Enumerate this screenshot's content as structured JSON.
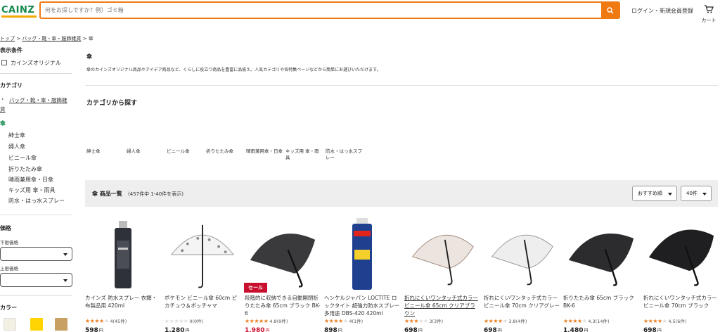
{
  "header": {
    "logo": "CAINZ",
    "search_placeholder": "何をお探しですか？例）ゴミ箱",
    "login": "ログイン・新規会員登録",
    "cart": "カート"
  },
  "breadcrumb": {
    "home": "トップ",
    "sep": ">",
    "parent": "バッグ・靴・傘・服飾雑貨",
    "current": "傘"
  },
  "sidebar": {
    "filter_title": "表示条件",
    "cainz_original": "カインズオリジナル",
    "category_title": "カテゴリ",
    "back_link_line1": "バッグ・靴・傘・服飾雑",
    "back_link_line2": "貨",
    "current": "傘",
    "subcategories": [
      "紳士傘",
      "婦人傘",
      "ビニール傘",
      "折りたたみ傘",
      "晴雨兼用傘・日傘",
      "キッズ用 傘・雨具",
      "防水・はっ水スプレー"
    ],
    "price_title": "価格",
    "lower_price": "下限価格",
    "upper_price": "上限価格",
    "color_title": "カラー",
    "colors": [
      "#f3efe3",
      "#ffd400",
      "#c8a063"
    ]
  },
  "main": {
    "title": "傘",
    "description": "傘のカインズオリジナル商品やアイデア商品など、くらしに役立つ商品を豊富に品揃え。人気カテゴリや各特集ページなどから簡単にお選びいただけます。",
    "category_heading": "カテゴリから探す",
    "categories": [
      [
        "紳士傘"
      ],
      [
        "婦人傘"
      ],
      [
        "ビニール傘"
      ],
      [
        "折りたたみ傘"
      ],
      [
        "晴雨兼用傘・日傘"
      ],
      [
        "キッズ用 傘・雨",
        "具"
      ],
      [
        "防水・はっ水スプ",
        "レー"
      ]
    ],
    "list_title": "傘 商品一覧",
    "list_count": "(457件中 1-40件を表示)",
    "sort": "おすすめ順",
    "per_page": "40件"
  },
  "products": [
    {
      "name": "カインズ 防水スプレー 衣類・布製品用 420ml",
      "rating": 4.0,
      "rating_text": "4(45件)",
      "price": "598",
      "yen": "円",
      "sale": false,
      "link": false
    },
    {
      "name": "ポケモン ビニール傘 60cm ピカチュウ＆ポッチャマ",
      "rating": 0,
      "rating_text": "0(0件)",
      "price": "1,280",
      "yen": "円",
      "sale": false,
      "link": false
    },
    {
      "name": "段階的に収納できる自動開閉折りたたみ傘 65cm ブラック BK-6",
      "rating": 4.8,
      "rating_text": "4.8(9件)",
      "price": "1,980",
      "yen": "円",
      "sale": true,
      "sale_label": "セール",
      "link": false
    },
    {
      "name": "ヘンケルジャパン LOCTITE ロックタイト 超強力防水スプレー 多用途 DBS-420 420ml",
      "rating": 4.0,
      "rating_text": "4(1件)",
      "price": "898",
      "yen": "円",
      "sale": false,
      "link": false
    },
    {
      "name": "折れにくいワンタッチ式カラービニール傘 65cm クリアブラウン",
      "rating": 3.0,
      "rating_text": "3(3件)",
      "price": "698",
      "yen": "円",
      "sale": false,
      "link": true
    },
    {
      "name": "折れにくいワンタッチ式カラービニール傘 70cm クリアグレー",
      "rating": 3.8,
      "rating_text": "3.8(4件)",
      "price": "698",
      "yen": "円",
      "sale": false,
      "link": false
    },
    {
      "name": "折りたたみ傘 65cm ブラック BK-6",
      "rating": 4.3,
      "rating_text": "4.3(14件)",
      "price": "1,480",
      "yen": "円",
      "sale": false,
      "link": false
    },
    {
      "name": "折れにくいワンタッチ式カラービニール傘 70cm ブラック",
      "rating": 4.5,
      "rating_text": "4.5(6件)",
      "price": "698",
      "yen": "円",
      "sale": false,
      "link": false
    }
  ]
}
